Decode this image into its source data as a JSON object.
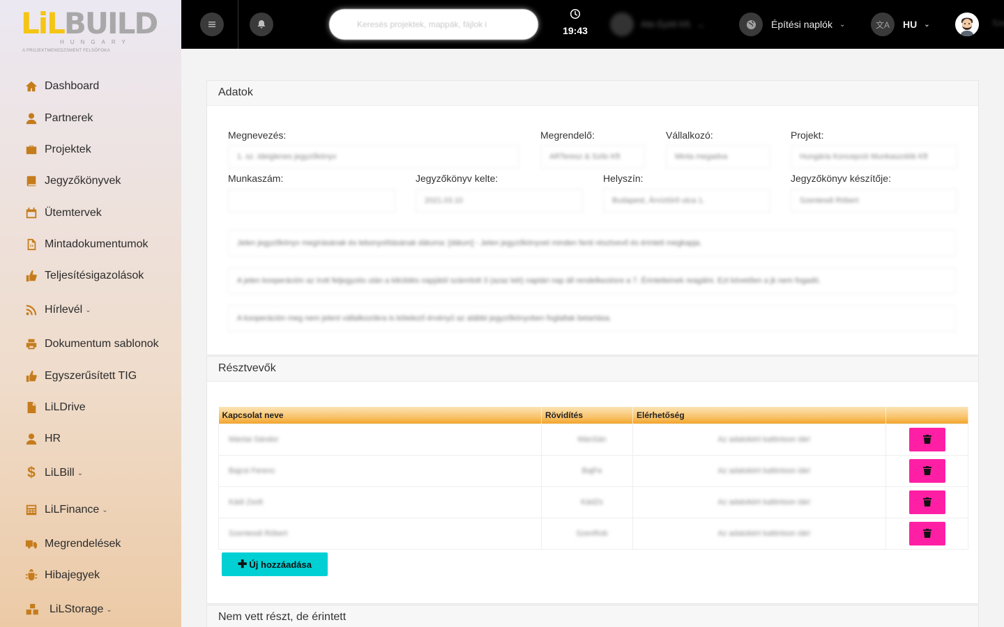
{
  "logo": {
    "li": "LiL",
    "build": "BUILD",
    "country": "HUNGARY",
    "tagline": "A PROJEKTMENEDZSMENT FELSŐFOKA"
  },
  "sidebar": {
    "items": [
      {
        "label": "Dashboard",
        "icon": "home-icon"
      },
      {
        "label": "Partnerek",
        "icon": "user-icon"
      },
      {
        "label": "Projektek",
        "icon": "briefcase-icon"
      },
      {
        "label": "Jegyzőkönyvek",
        "icon": "book-icon"
      },
      {
        "label": "Ütemtervek",
        "icon": "calendar-icon"
      },
      {
        "label": "Mintadokumentumok",
        "icon": "code-file-icon"
      },
      {
        "label": "Teljesítésigazolások",
        "icon": "thumbs-up-icon"
      },
      {
        "label": "Hírlevél",
        "icon": "rss-icon",
        "has_caret": true
      },
      {
        "label": "Dokumentum sablonok",
        "icon": "printer-icon"
      },
      {
        "label": "Egyszerűsített TIG",
        "icon": "thumbs-up-icon"
      },
      {
        "label": "LiLDrive",
        "icon": "file-icon"
      },
      {
        "label": "HR",
        "icon": "user-icon"
      },
      {
        "label": "LiLBill",
        "icon": "dollar-icon",
        "has_caret": true
      },
      {
        "label": "LiLFinance",
        "icon": "calculator-icon",
        "has_caret": true
      },
      {
        "label": "Megrendelések",
        "icon": "truck-icon"
      },
      {
        "label": "Hibajegyek",
        "icon": "bug-icon"
      },
      {
        "label": "LiLStorage",
        "icon": "boxes-icon",
        "has_caret": true
      }
    ]
  },
  "topbar": {
    "search_placeholder": "Keresés projektek, mappák, fájlok i",
    "time": "19:43",
    "company": "Alte Építő Kft.",
    "diaries": "Építési naplók",
    "language": "HU",
    "cut_text": "Sze"
  },
  "data_card": {
    "title": "Adatok",
    "labels": {
      "name": "Megnevezés:",
      "client": "Megrendelő:",
      "contractor": "Vállalkozó:",
      "project": "Projekt:",
      "job_number": "Munkaszám:",
      "date": "Jegyzőkönyv kelte:",
      "location": "Helyszín:",
      "author": "Jegyzőkönyv készítője:"
    },
    "values": {
      "name": "1. sz. ideiglenes jegyzőkönyv",
      "client": "ARTeresz & Szilo Kft",
      "contractor": "Minta megadva",
      "project": "Hungária Koncepció Munkaszolób Kft",
      "job_number": "",
      "date": "2021.03.10",
      "location": "Budapest, Árvíztűrő utca 1.",
      "author": "Szentesdi Róbert"
    },
    "notes": [
      "Jelen jegyzőkönyv megírásának és lebonyolításának dátuma: [dátum] - Jelen jegyzőkönyvet minden fenti résztvevő és érintett megkapja.",
      "A jelen kooperáción az írott feljegyzés után a kiküldés napjától számított 3 (azaz két) naptári nap áll rendelkezésre a 7. Érintetteinek reagálni. Ezt követően a jk nem fogadó.",
      "A kooperáción meg nem jelent vállalkozókra is kötelező érvényű az alábbi jegyzőkönyvben foglaltak betartása."
    ]
  },
  "participants_card": {
    "title": "Résztvevők",
    "columns": [
      "Kapcsolat neve",
      "Rövidítés",
      "Elérhetőség",
      ""
    ],
    "rows": [
      {
        "name": "Mántai Sándor",
        "abbr": "MánSán",
        "contact": "Az adatokért kattintson ide!"
      },
      {
        "name": "Bajcsi Ferenc",
        "abbr": "BajFe",
        "contact": "Az adatokért kattintson ide!"
      },
      {
        "name": "Kádi Zsolt",
        "abbr": "KádZs",
        "contact": "Az adatokért kattintson ide!"
      },
      {
        "name": "Szentesdi Róbert",
        "abbr": "SzenRob",
        "contact": "Az adatokért kattintson ide!"
      }
    ],
    "add_label": "Új hozzáadása"
  },
  "affected_card": {
    "title": "Nem vett részt, de érintett"
  },
  "colors": {
    "accent_pink": "#ff1fa5",
    "accent_teal": "#00d0d4",
    "icon_orange": "#c57c1c",
    "header_orange": "#f9c46d"
  }
}
